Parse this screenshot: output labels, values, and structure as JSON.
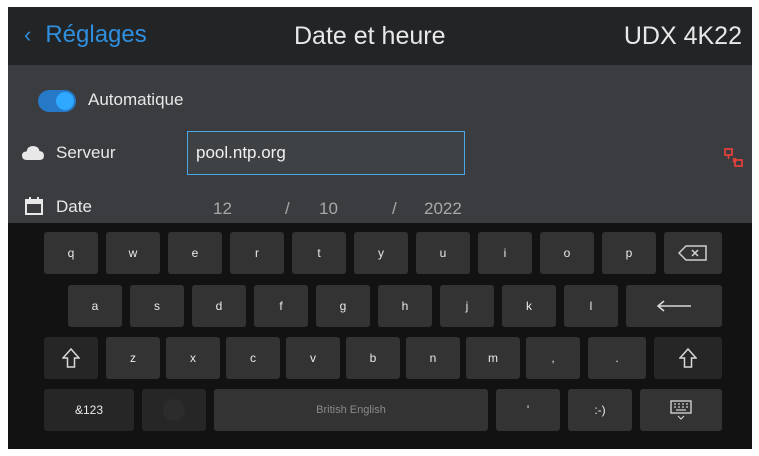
{
  "header": {
    "back_label": "Réglages",
    "title": "Date et heure",
    "model": "UDX 4K22"
  },
  "auto": {
    "label": "Automatique",
    "enabled": true
  },
  "server": {
    "label": "Serveur",
    "value": "pool.ntp.org"
  },
  "date": {
    "label": "Date",
    "day": "12",
    "month": "10",
    "year": "2022",
    "separator": "/"
  },
  "keyboard": {
    "row1": [
      "q",
      "w",
      "e",
      "r",
      "t",
      "y",
      "u",
      "i",
      "o",
      "p"
    ],
    "row2": [
      "a",
      "s",
      "d",
      "f",
      "g",
      "h",
      "j",
      "k",
      "l"
    ],
    "row3": [
      "z",
      "x",
      "c",
      "v",
      "b",
      "n",
      "m",
      ",",
      "."
    ],
    "symbols_label": "&123",
    "space_label": "British English",
    "apostrophe": "'",
    "smiley": ":-)"
  },
  "colors": {
    "accent": "#2f8fde",
    "header_bg": "#222426",
    "panel_bg": "#3a3c3f",
    "keyboard_bg": "#121212",
    "key_bg": "#333333",
    "network_icon": "#e0413a"
  }
}
